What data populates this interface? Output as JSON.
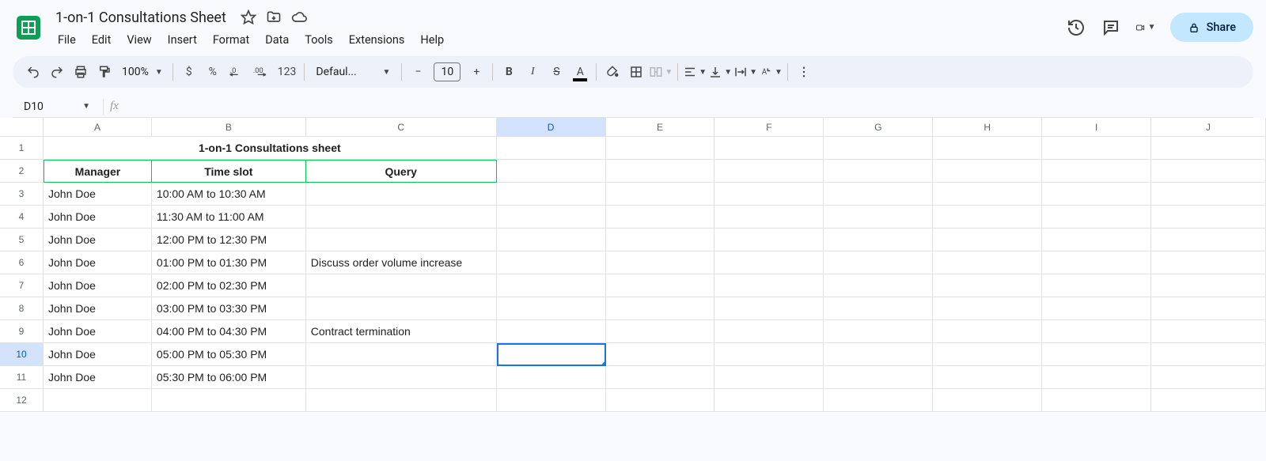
{
  "doc": {
    "title": "1-on-1 Consultations Sheet"
  },
  "menus": {
    "file": "File",
    "edit": "Edit",
    "view": "View",
    "insert": "Insert",
    "format": "Format",
    "data": "Data",
    "tools": "Tools",
    "extensions": "Extensions",
    "help": "Help"
  },
  "share": {
    "label": "Share"
  },
  "toolbar": {
    "zoom": "100%",
    "currency": "$",
    "percent": "%",
    "dec_dec": ".0",
    "inc_dec": ".00",
    "numfmt": "123",
    "font": "Defaul...",
    "fontsize": "10",
    "bold": "B",
    "italic": "I",
    "strike": "S",
    "textcolor": "A"
  },
  "namebox": {
    "ref": "D10"
  },
  "fx": {
    "label": "fx"
  },
  "columns": [
    "A",
    "B",
    "C",
    "D",
    "E",
    "F",
    "G",
    "H",
    "I",
    "J"
  ],
  "selected_col": "D",
  "selected_row": "10",
  "sheet": {
    "title": "1-on-1 Consultations sheet",
    "headers": {
      "a": "Manager",
      "b": "Time slot",
      "c": "Query"
    },
    "rows": [
      {
        "a": "John Doe",
        "b": "10:00 AM to 10:30 AM",
        "c": ""
      },
      {
        "a": "John Doe",
        "b": "11:30 AM to 11:00 AM",
        "c": ""
      },
      {
        "a": "John Doe",
        "b": "12:00 PM to 12:30 PM",
        "c": ""
      },
      {
        "a": "John Doe",
        "b": "01:00 PM to 01:30 PM",
        "c": "Discuss order volume increase"
      },
      {
        "a": "John Doe",
        "b": "02:00 PM to 02:30 PM",
        "c": ""
      },
      {
        "a": "John Doe",
        "b": "03:00 PM to 03:30 PM",
        "c": ""
      },
      {
        "a": "John Doe",
        "b": "04:00 PM to 04:30 PM",
        "c": "Contract termination"
      },
      {
        "a": "John Doe",
        "b": "05:00 PM to 05:30 PM",
        "c": ""
      },
      {
        "a": "John Doe",
        "b": "05:30 PM to 06:00 PM",
        "c": ""
      }
    ]
  }
}
